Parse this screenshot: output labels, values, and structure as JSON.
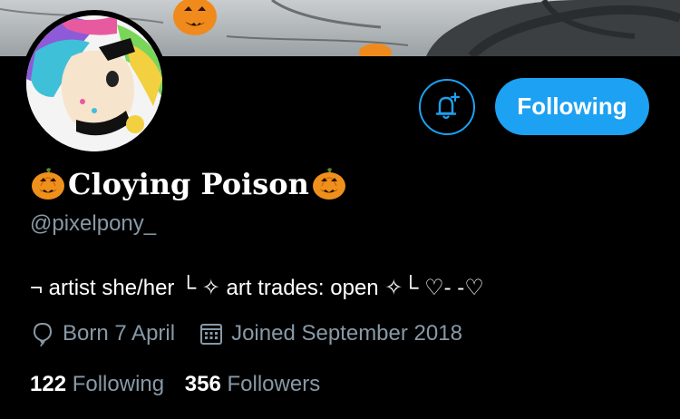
{
  "banner": {
    "image": "halloween-tree-with-pumpkins"
  },
  "profile": {
    "display_name": "Cloying Poison",
    "name_emoji": "pumpkin-icon",
    "handle": "@pixelpony_",
    "bio": "¬ artist she/her └ ✧ art trades: open ✧└ ♡- -♡",
    "birthday": "Born 7 April",
    "joined": "Joined September 2018",
    "following_count": "122",
    "following_label": "Following",
    "followers_count": "356",
    "followers_label": "Followers"
  },
  "actions": {
    "notify_icon": "bell-plus-icon",
    "follow_button_label": "Following"
  },
  "colors": {
    "accent": "#1da1f2",
    "muted": "#8899a6",
    "background": "#000000"
  }
}
